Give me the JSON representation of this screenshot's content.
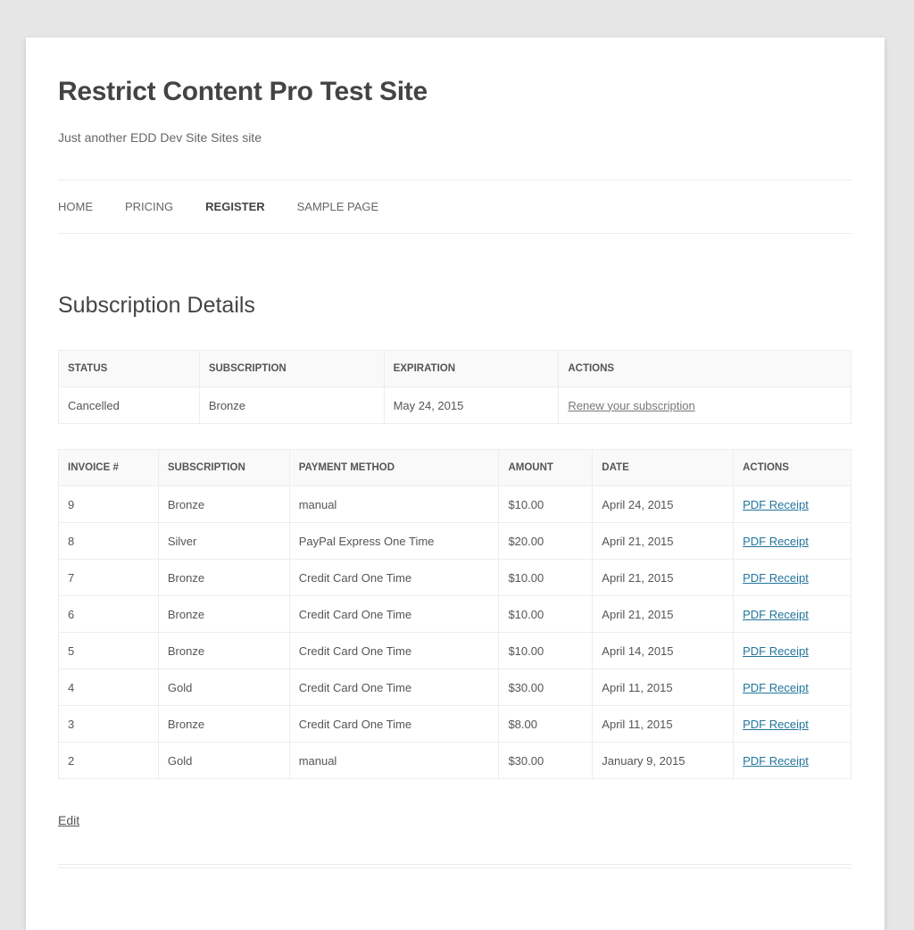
{
  "site": {
    "title": "Restrict Content Pro Test Site",
    "description": "Just another EDD Dev Site Sites site"
  },
  "nav": {
    "items": [
      {
        "label": "HOME"
      },
      {
        "label": "PRICING"
      },
      {
        "label": "REGISTER",
        "current": true
      },
      {
        "label": "SAMPLE PAGE"
      }
    ]
  },
  "main": {
    "title": "Subscription Details",
    "subscription_table": {
      "headers": [
        "STATUS",
        "SUBSCRIPTION",
        "EXPIRATION",
        "ACTIONS"
      ],
      "row": {
        "status": "Cancelled",
        "subscription": "Bronze",
        "expiration": "May 24, 2015",
        "action": "Renew your subscription"
      }
    },
    "invoice_table": {
      "headers": [
        "INVOICE #",
        "SUBSCRIPTION",
        "PAYMENT METHOD",
        "AMOUNT",
        "DATE",
        "ACTIONS"
      ],
      "rows": [
        {
          "invoice": "9",
          "subscription": "Bronze",
          "method": "manual",
          "amount": "$10.00",
          "date": "April 24, 2015",
          "action": "PDF Receipt"
        },
        {
          "invoice": "8",
          "subscription": "Silver",
          "method": "PayPal Express One Time",
          "amount": "$20.00",
          "date": "April 21, 2015",
          "action": "PDF Receipt"
        },
        {
          "invoice": "7",
          "subscription": "Bronze",
          "method": "Credit Card One Time",
          "amount": "$10.00",
          "date": "April 21, 2015",
          "action": "PDF Receipt"
        },
        {
          "invoice": "6",
          "subscription": "Bronze",
          "method": "Credit Card One Time",
          "amount": "$10.00",
          "date": "April 21, 2015",
          "action": "PDF Receipt"
        },
        {
          "invoice": "5",
          "subscription": "Bronze",
          "method": "Credit Card One Time",
          "amount": "$10.00",
          "date": "April 14, 2015",
          "action": "PDF Receipt"
        },
        {
          "invoice": "4",
          "subscription": "Gold",
          "method": "Credit Card One Time",
          "amount": "$30.00",
          "date": "April 11, 2015",
          "action": "PDF Receipt"
        },
        {
          "invoice": "3",
          "subscription": "Bronze",
          "method": "Credit Card One Time",
          "amount": "$8.00",
          "date": "April 11, 2015",
          "action": "PDF Receipt"
        },
        {
          "invoice": "2",
          "subscription": "Gold",
          "method": "manual",
          "amount": "$30.00",
          "date": "January 9, 2015",
          "action": "PDF Receipt"
        }
      ]
    },
    "edit_label": "Edit"
  },
  "colors": {
    "link": "#21759b",
    "text": "#444444",
    "background": "#e6e6e6"
  }
}
